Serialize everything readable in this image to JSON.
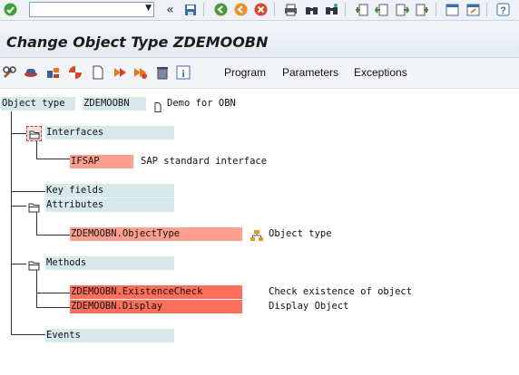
{
  "title": "Change Object Type ZDEMOOBN",
  "toolbar": {
    "command_value": "",
    "icons": [
      "check-icon",
      "back-arrows-icon",
      "save-icon",
      "back-icon",
      "exit-icon",
      "cancel-icon",
      "print-icon",
      "find-icon",
      "find-next-icon",
      "first-page-icon",
      "prev-page-icon",
      "next-page-icon",
      "last-page-icon",
      "new-session-icon",
      "shortcut-icon",
      "help-icon"
    ]
  },
  "app_toolbar": {
    "icons": [
      "display-change-icon",
      "test-icon",
      "generate-icon",
      "create-subtype-icon",
      "document-icon",
      "where-used-icon",
      "delegate-icon",
      "delete-icon",
      "info-icon"
    ],
    "menus": [
      "Program",
      "Parameters",
      "Exceptions"
    ]
  },
  "tree": {
    "root_label": "Object type",
    "root_value": "ZDEMOOBN",
    "root_desc": "Demo for OBN",
    "interfaces_label": "Interfaces",
    "interface_name": "IFSAP",
    "interface_desc": "SAP standard interface",
    "keyfields_label": "Key fields",
    "attributes_label": "Attributes",
    "attribute_name": "ZDEMOOBN.ObjectType",
    "attribute_desc": "Object type",
    "methods_label": "Methods",
    "methods": [
      {
        "name": "ZDEMOOBN.ExistenceCheck",
        "desc": "Check existence of object"
      },
      {
        "name": "ZDEMOOBN.Display",
        "desc": "Display Object"
      }
    ],
    "events_label": "Events"
  },
  "colors": {
    "teal_field": "#d6e9eb",
    "interface_field": "#fd9f8e",
    "method_field": "#fc6f5c"
  }
}
